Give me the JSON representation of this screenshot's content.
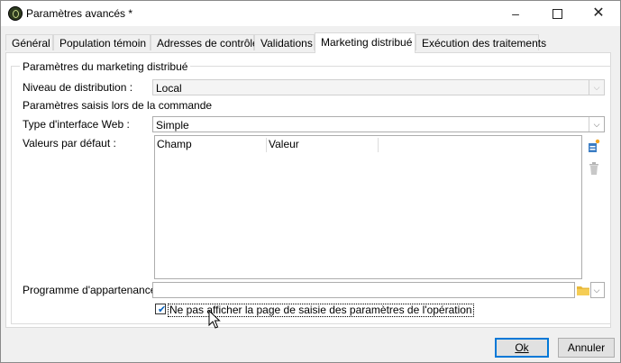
{
  "window": {
    "title": "Paramètres avancés *",
    "controls": {
      "minimize": "–",
      "close": "✕"
    }
  },
  "tabs": [
    {
      "label": "Général",
      "active": false
    },
    {
      "label": "Population témoin",
      "active": false
    },
    {
      "label": "Adresses de contrôle",
      "active": false
    },
    {
      "label": "Validations",
      "active": false
    },
    {
      "label": "Marketing distribué",
      "active": true
    },
    {
      "label": "Exécution des traitements",
      "active": false
    }
  ],
  "panel": {
    "group_title": "Paramètres du marketing distribué",
    "distribution": {
      "label": "Niveau de distribution :",
      "value": "Local"
    },
    "order_section": "Paramètres saisis lors de la commande",
    "web_interface": {
      "label": "Type d'interface Web :",
      "value": "Simple"
    },
    "defaults": {
      "label": "Valeurs par défaut :",
      "columns": [
        "Champ",
        "Valeur"
      ],
      "icons": {
        "add": "add-icon",
        "delete": "trash-icon"
      }
    },
    "program": {
      "label": "Programme d'appartenance :",
      "value": "",
      "folder_icon": "folder-icon"
    },
    "hide_page": {
      "label": "Ne pas afficher la page de saisie des paramètres de l'opération",
      "checked": true
    }
  },
  "buttons": {
    "ok": "Ok",
    "cancel": "Annuler"
  },
  "colors": {
    "accent": "#0078d7",
    "panel_bg": "#ffffff",
    "window_bg": "#f0f0f0"
  }
}
